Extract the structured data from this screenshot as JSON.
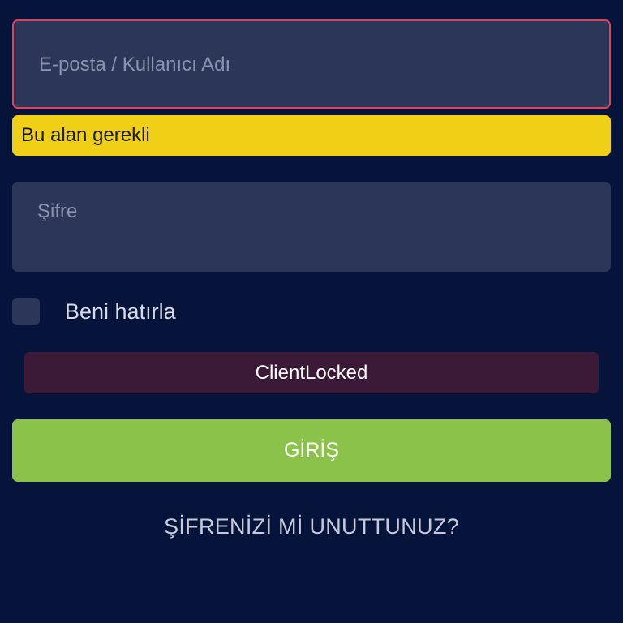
{
  "login_form": {
    "email_placeholder": "E-posta / Kullanıcı Adı",
    "email_value": "",
    "email_error": "Bu alan gerekli",
    "password_placeholder": "Şifre",
    "password_value": "",
    "remember_label": "Beni hatırla",
    "remember_checked": false,
    "status_message": "ClientLocked",
    "submit_label": "GİRİŞ",
    "forgot_password_label": "ŞİFRENİZİ Mİ UNUTTUNUZ?"
  },
  "colors": {
    "background": "#06133a",
    "field_background": "#2b3658",
    "error_border": "#e0425a",
    "warning_banner": "#f0d016",
    "locked_banner": "#3b1a38",
    "primary_button": "#8bc34a"
  }
}
